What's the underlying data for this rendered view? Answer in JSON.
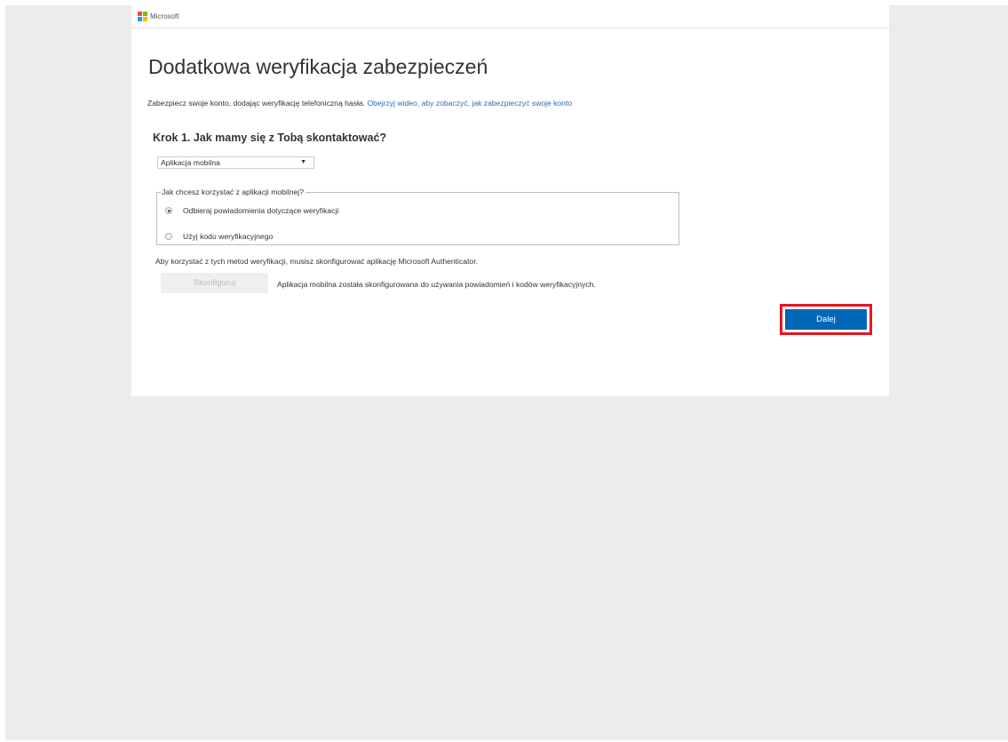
{
  "header": {
    "brand": "Microsoft",
    "logo_colors": {
      "red": "#f25022",
      "green": "#7fba00",
      "blue": "#00a4ef",
      "yellow": "#ffb900"
    }
  },
  "page": {
    "title": "Dodatkowa weryfikacja zabezpieczeń",
    "intro_text": "Zabezpiecz swoje konto, dodając weryfikację telefoniczną hasła.",
    "intro_link": "Obejrzyj wideo, aby zobaczyć, jak zabezpieczyć swoje konto"
  },
  "step": {
    "title": "Krok 1. Jak mamy się z Tobą skontaktować?",
    "contact_method": {
      "selected": "Aplikacja mobilna",
      "arrow": "▼"
    },
    "mobile_app_group": {
      "legend": "Jak chcesz korzystać z aplikacji mobilnej?",
      "options": [
        {
          "label": "Odbieraj powiadomienia dotyczące weryfikacji",
          "checked": true
        },
        {
          "label": "Użyj kodu weryfikacyjnego",
          "checked": false
        }
      ]
    },
    "config_note": "Aby korzystać z tych metod weryfikacji, musisz skonfigurować aplikację Microsoft Authenticator.",
    "configure_button": "Skonfiguruj",
    "configure_status": "Aplikacja mobilna została skonfigurowana do używania powiadomień i kodów weryfikacyjnych."
  },
  "actions": {
    "next_label": "Dalej"
  },
  "colors": {
    "accent": "#0067b8",
    "link": "#2b6db3",
    "highlight_border": "#e8141d",
    "page_background": "#ececec"
  }
}
